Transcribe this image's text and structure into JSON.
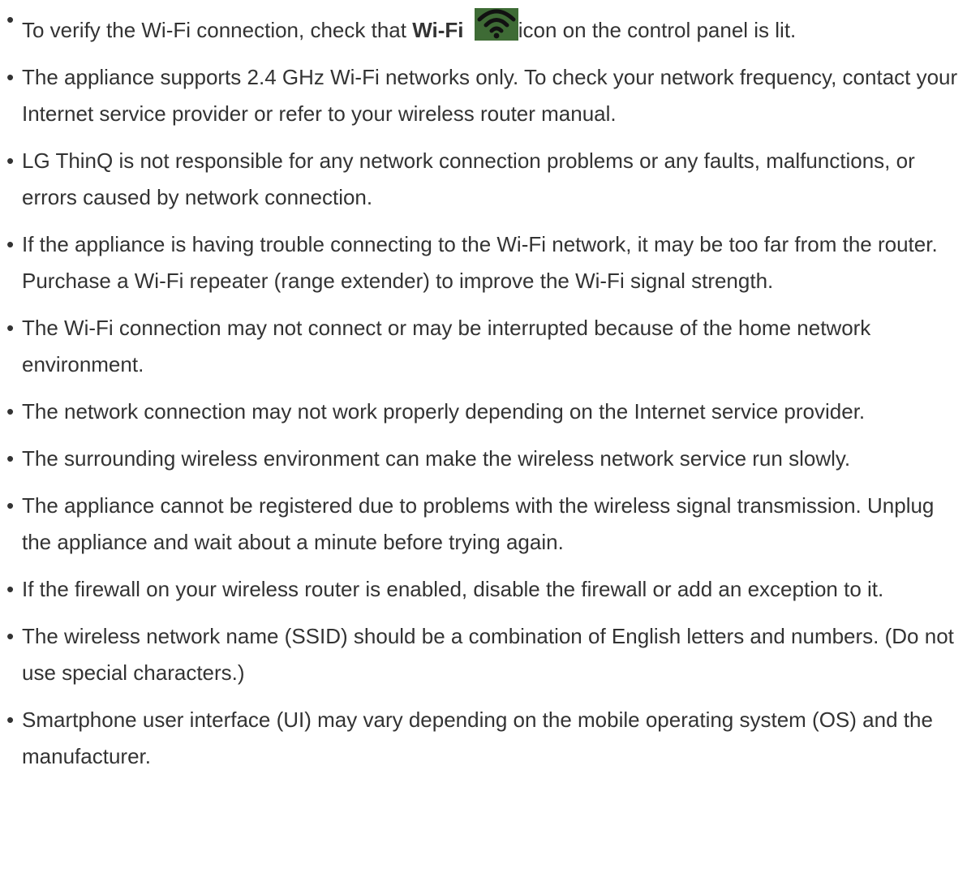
{
  "notes": {
    "bullet_char": "•",
    "first": {
      "before": "To verify the Wi-Fi connection, check that ",
      "bold": "Wi-Fi",
      "after": "icon on the control panel is lit.",
      "icon": "wifi-icon",
      "icon_background": "#3e6b35",
      "icon_foreground": "#111111"
    },
    "items": [
      "The appliance supports 2.4 GHz Wi-Fi networks only. To check your network frequency, contact your Internet service provider or refer to your wireless router manual.",
      "LG ThinQ is not responsible for any network connection problems or any faults, malfunctions, or errors caused by network connection.",
      "If the appliance is having trouble connecting to the Wi-Fi network, it may be too far from the router. Purchase a Wi-Fi repeater (range extender) to improve the Wi-Fi signal strength.",
      "The Wi-Fi connection may not connect or may be interrupted because of the home network environment.",
      "The network connection may not work properly depending on the Internet service provider.",
      "The surrounding wireless environment can make the wireless network service run slowly.",
      "The appliance cannot be registered due to problems with the wireless signal transmission. Unplug the appliance and wait about a minute before trying again.",
      "If the firewall on your wireless router is enabled, disable the firewall or add an exception to it.",
      "The wireless network name (SSID) should be a combination of English letters and numbers. (Do not use special characters.)",
      "Smartphone user interface (UI) may vary depending on the mobile operating system (OS) and the manufacturer."
    ]
  }
}
